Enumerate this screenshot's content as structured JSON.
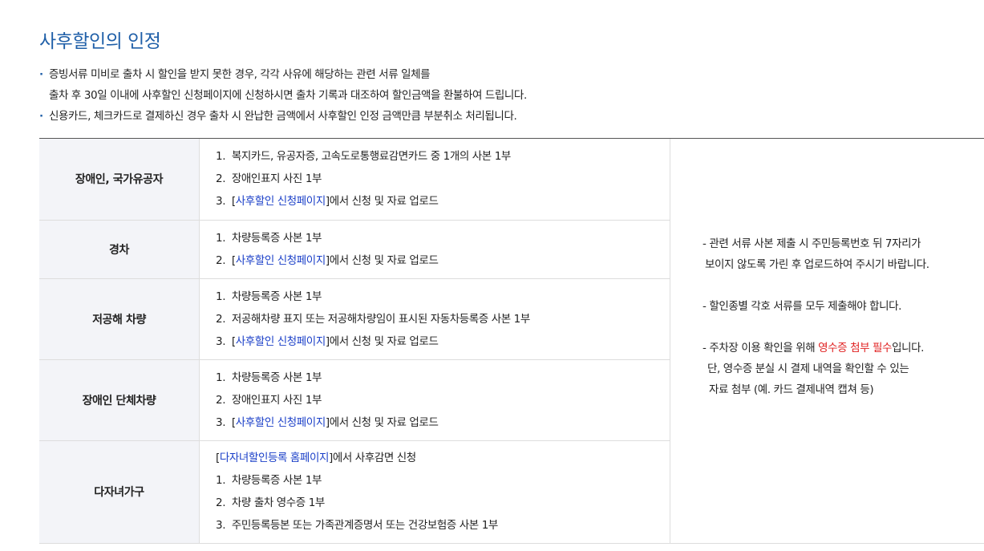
{
  "title": "사후할인의 인정",
  "bullets": {
    "b1_line1": "증빙서류 미비로 출차 시 할인을 받지 못한 경우, 각각 사유에 해당하는 관련 서류 일체를",
    "b1_line2": "출차 후 30일 이내에 사후할인 신청페이지에 신청하시면 출차 기록과 대조하여 할인금액을 환불하여 드립니다.",
    "b2": "신용카드, 체크카드로 결제하신 경우 출차 시 완납한 금액에서 사후할인 인정 금액만큼 부분취소 처리됩니다.",
    "dot": "·"
  },
  "rows": [
    {
      "category": "장애인, 국가유공자",
      "items": [
        {
          "num": "1.",
          "text": "복지카드, 유공자증, 고속도로통행료감면카드 중 1개의 사본 1부"
        },
        {
          "num": "2.",
          "text": "장애인표지 사진 1부"
        },
        {
          "num": "3.",
          "open": "[",
          "link": "사후할인 신청페이지",
          "rest": "]에서 신청 및 자료 업로드"
        }
      ]
    },
    {
      "category": "경차",
      "items": [
        {
          "num": "1.",
          "text": "차량등록증 사본 1부"
        },
        {
          "num": "2.",
          "open": "[",
          "link": "사후할인 신청페이지",
          "rest": "]에서 신청 및 자료 업로드"
        }
      ]
    },
    {
      "category": "저공해 차량",
      "items": [
        {
          "num": "1.",
          "text": "차량등록증 사본 1부"
        },
        {
          "num": "2.",
          "text": "저공해차량 표지 또는 저공해차량임이 표시된 자동차등록증 사본 1부"
        },
        {
          "num": "3.",
          "open": "[",
          "link": "사후할인 신청페이지",
          "rest": "]에서 신청 및 자료 업로드"
        }
      ]
    },
    {
      "category": "장애인 단체차량",
      "items": [
        {
          "num": "1.",
          "text": "차량등록증 사본 1부"
        },
        {
          "num": "2.",
          "text": "장애인표지 사진 1부"
        },
        {
          "num": "3.",
          "open": "[",
          "link": "사후할인 신청페이지",
          "rest": "]에서 신청 및 자료 업로드"
        }
      ]
    },
    {
      "category": "다자녀가구",
      "intro": {
        "open": "[",
        "link": "다자녀할인등록 홈페이지",
        "rest": "]에서 사후감면 신청"
      },
      "items": [
        {
          "num": "1.",
          "text": "차량등록증 사본 1부"
        },
        {
          "num": "2.",
          "text": "차량 출차 영수증 1부"
        },
        {
          "num": "3.",
          "text": "주민등록등본 또는 가족관계증명서 또는 건강보험증 사본 1부"
        }
      ]
    }
  ],
  "notes": {
    "n1_line1": "- 관련 서류 사본 제출 시 주민등록번호 뒤 7자리가",
    "n1_line2": "보이지 않도록 가린 후 업로드하여 주시기 바랍니다.",
    "n2": "- 할인종별 각호 서류를 모두 제출해야 합니다.",
    "n3_pre": "- 주차장 이용 확인을 위해 ",
    "n3_red": "영수증 첨부 필수",
    "n3_post": "입니다.",
    "n3_line2": "단, 영수증 분실 시 결제 내역을 확인할 수 있는",
    "n3_line3": "자료 첨부 (예. 카드 결제내역 캡쳐 등)"
  },
  "colors": {
    "title": "#1f5fa8",
    "link": "#1a3fc8",
    "emphasis": "#e02020",
    "category_bg": "#f3f4f8"
  }
}
